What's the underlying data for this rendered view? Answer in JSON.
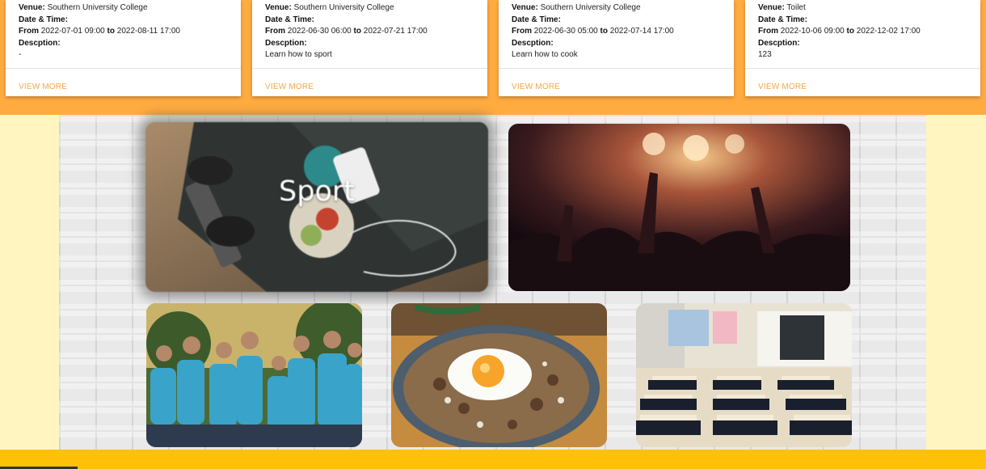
{
  "labels": {
    "venue": "Venue:",
    "date_time": "Date & Time:",
    "from": "From",
    "to": "to",
    "description": "Descption:"
  },
  "events": [
    {
      "venue": "Southern University College",
      "from": "2022-07-01 09:00",
      "to": "2022-08-11 17:00",
      "description": "-",
      "action": "VIEW MORE"
    },
    {
      "venue": "Southern University College",
      "from": "2022-06-30 06:00",
      "to": "2022-07-21 17:00",
      "description": "Learn how to sport",
      "action": "VIEW MORE"
    },
    {
      "venue": "Southern University College",
      "from": "2022-06-30 05:00",
      "to": "2022-07-14 17:00",
      "description": "Learn how to cook",
      "action": "VIEW MORE"
    },
    {
      "venue": "Toilet",
      "from": "2022-10-06 09:00",
      "to": "2022-12-02 17:00",
      "description": "123",
      "action": "VIEW MORE"
    }
  ],
  "gallery": {
    "sport_caption": "Sport",
    "tiles": [
      "sport-image",
      "concert-image",
      "volunteer-image",
      "cooking-image",
      "classroom-image"
    ]
  },
  "colors": {
    "band": "#ffab40",
    "link": "#f5a64a",
    "page_bg": "#fff5c0",
    "footer": "#ffc107"
  }
}
